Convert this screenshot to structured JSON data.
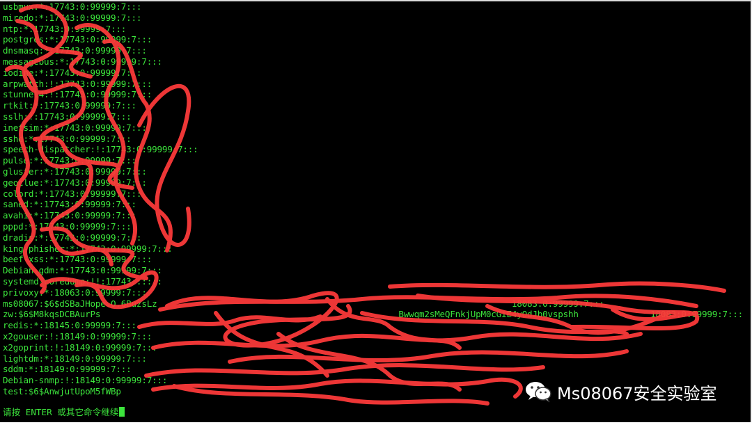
{
  "terminal": {
    "lines": [
      "usbmux:*:17743:0:99999:7:::",
      "miredo:*:17743:0:99999:7:::",
      "ntp:*:17743:0:99999:7:::",
      "postgres:*:17743:0:99999:7:::",
      "dnsmasq:*:17743:0:99999:7:::",
      "messagebus:*:17743:0:99999:7:::",
      "iodine:*:17743:0:99999:7:::",
      "arpwatch:!:17743:0:99999:7:::",
      "stunnel4:!:17743:0:99999:7:::",
      "rtkit:*:17743:0:99999:7:::",
      "sslh:!:17743:0:99999:7:::",
      "inetsim:*:17743:0:99999:7:::",
      "sshd:*:17743:0:99999:7:::",
      "speech-dispatcher:!:17743:0:99999:7:::",
      "pulse:*:17743:0:99999:7:::",
      "gluster:*:17743:0:99999:7:::",
      "geoclue:*:17743:0:99999:7:::",
      "colord:*:17743:0:99999:7:::",
      "saned:*:17743:0:99999:7:::",
      "avahi:*:17743:0:99999:7:::",
      "pppd:*:17743:0:99999:7:::",
      "dradis:*:17743:0:99999:7:::",
      "king-phisher:*:17743:0:99999:7:::",
      "beef-xss:*:17743:0:99999:7:::",
      "Debian-gdm:*:17743:0:99999:7:::",
      "systemd-coredump:!!:17743::::::",
      "privoxy:*:18063:0:99999:7:::",
      "ms08067:$6$dSBaJHope.O.6BuzsLz                                                                     18083:0:99999:7:::",
      "zw:$6$M8kqsDCBAurPs                                                          Bwwqm2sMeQFnkjUpM0cGiE4yOdJb0vspshh              18083:0:99999:7:::",
      "redis:*:18145:0:99999:7:::",
      "x2gouser:!:18149:0:99999:7:::",
      "x2goprint:!:18149:0:99999:7:::",
      "lightdm:*:18149:0:99999:7:::",
      "sddm:*:18149:0:99999:7:::",
      "Debian-snmp:!:18149:0:99999:7:::",
      "test:$6$AnwjutUpoM5fWBp"
    ],
    "prompt": "请按 ENTER 或其它命令继续"
  },
  "watermark": {
    "text": "Ms08067安全实验室",
    "icon": "wechat-icon"
  },
  "colors": {
    "background": "#000000",
    "terminal_text": "#3ce43c",
    "scribble": "#ff3b3b"
  }
}
